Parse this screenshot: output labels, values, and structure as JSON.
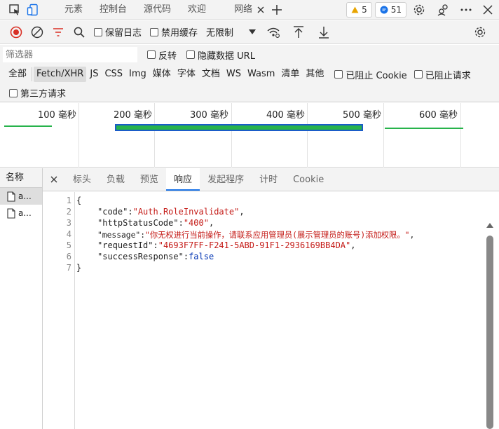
{
  "tabs": [
    {
      "label": "元素"
    },
    {
      "label": "控制台"
    },
    {
      "label": "源代码"
    },
    {
      "label": "欢迎"
    },
    {
      "label": "网络"
    }
  ],
  "badges": {
    "warnings": "5",
    "messages": "51"
  },
  "toolbar": {
    "preserve_log": "保留日志",
    "disable_cache": "禁用缓存",
    "throttle": "无限制"
  },
  "filter": {
    "placeholder": "筛选器",
    "invert": "反转",
    "hide_data_urls": "隐藏数据 URL"
  },
  "type_filters": [
    "全部",
    "Fetch/XHR",
    "JS",
    "CSS",
    "Img",
    "媒体",
    "字体",
    "文档",
    "WS",
    "Wasm",
    "清单",
    "其他"
  ],
  "blocked": {
    "cookies": "已阻止 Cookie",
    "requests": "已阻止请求",
    "third_party": "第三方请求"
  },
  "timeline": {
    "ticks": [
      "100 毫秒",
      "200 毫秒",
      "300 毫秒",
      "400 毫秒",
      "500 毫秒",
      "600 毫秒"
    ]
  },
  "names": {
    "header": "名称",
    "items": [
      "a...",
      "a..."
    ]
  },
  "detail_tabs": [
    "标头",
    "负载",
    "预览",
    "响应",
    "发起程序",
    "计时",
    "Cookie"
  ],
  "response": {
    "line_numbers": [
      "1",
      "2",
      "3",
      "4",
      "5",
      "6",
      "7"
    ],
    "open": "{",
    "close": "}",
    "code_key": "\"code\"",
    "code_val": "\"Auth.RoleInvalidate\"",
    "status_key": "\"httpStatusCode\"",
    "status_val": "\"400\"",
    "message_key": "\"message\"",
    "message_val": "\"你无权进行当前操作，请联系应用管理员(展示管理员的账号)添加权限。\"",
    "request_key": "\"requestId\"",
    "request_val": "\"4693F7FF-F241-5ABD-91F1-2936169BB4DA\"",
    "success_key": "\"successResponse\"",
    "success_val": "false"
  },
  "colors": {
    "accent": "#1a73e8",
    "record_red": "#d93025",
    "string_red": "#c41a16",
    "bool_blue": "#0033b3",
    "timeline_green": "#27b34b",
    "timeline_blue": "#1a5cc8"
  }
}
